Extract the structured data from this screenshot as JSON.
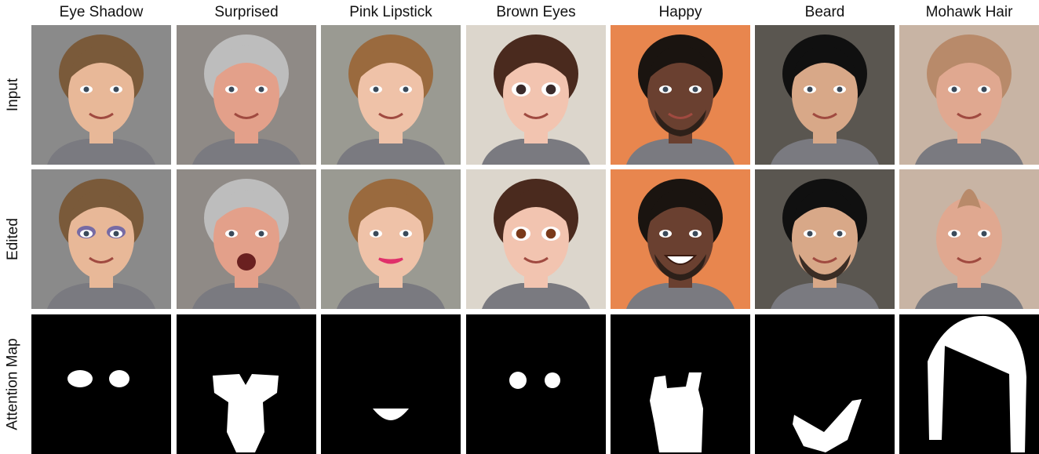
{
  "columns": [
    {
      "label": "Eye Shadow",
      "bg": "#8a8a8a",
      "skin": "#e8b898",
      "hair": "#7a5a3a",
      "edit": "eyeshadow"
    },
    {
      "label": "Surprised",
      "bg": "#8f8a86",
      "skin": "#e3a08a",
      "hair": "#bdbdbd",
      "edit": "surprised"
    },
    {
      "label": "Pink Lipstick",
      "bg": "#9a9a92",
      "skin": "#efc2a8",
      "hair": "#9a6a3e",
      "edit": "lipstick"
    },
    {
      "label": "Brown Eyes",
      "bg": "#dcd6cc",
      "skin": "#f2c4b0",
      "hair": "#4a2a1e",
      "edit": "browneyes"
    },
    {
      "label": "Happy",
      "bg": "#e8864e",
      "skin": "#6a4030",
      "hair": "#1a1410",
      "edit": "happy"
    },
    {
      "label": "Beard",
      "bg": "#5a5650",
      "skin": "#d8a888",
      "hair": "#101010",
      "edit": "beard"
    },
    {
      "label": "Mohawk Hair",
      "bg": "#c8b4a4",
      "skin": "#e0a890",
      "hair": "#b88a6a",
      "edit": "mohawk"
    }
  ],
  "rows": [
    {
      "label": "Input",
      "kind": "input"
    },
    {
      "label": "Edited",
      "kind": "edited"
    },
    {
      "label": "Attention Map",
      "kind": "attention"
    }
  ]
}
